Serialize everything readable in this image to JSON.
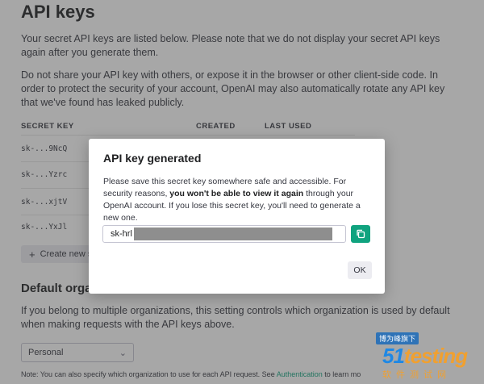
{
  "page": {
    "title": "API keys",
    "intro": "Your secret API keys are listed below. Please note that we do not display your secret API keys again after you generate them.",
    "warning": "Do not share your API key with others, or expose it in the browser or other client-side code. In order to protect the security of your account, OpenAI may also automatically rotate any API key that we've found has leaked publicly."
  },
  "table": {
    "headers": [
      "SECRET KEY",
      "CREATED",
      "LAST USED"
    ],
    "rows": [
      "sk-...9NcQ",
      "sk-...Yzrc",
      "sk-...xjtV",
      "sk-...YxJl"
    ]
  },
  "create_button": "Create new se",
  "default_org": {
    "heading": "Default organ",
    "text": "If you belong to multiple organizations, this setting controls which organization is used by default when making requests with the API keys above.",
    "selected": "Personal",
    "note_prefix": "Note: You can also specify which organization to use for each API request. See ",
    "note_link": "Authentication",
    "note_suffix": " to learn mo"
  },
  "modal": {
    "title": "API key generated",
    "text_a": "Please save this secret key somewhere safe and accessible. For security reasons, ",
    "text_bold": "you won't be able to view it again",
    "text_b": " through your OpenAI account. If you lose this secret key, you'll need to generate a new one.",
    "key_prefix": "sk-hrl",
    "ok_label": "OK"
  },
  "watermark": {
    "top": "博为峰旗下",
    "main_a": "51",
    "main_b": "testing",
    "bottom": "软件测试网"
  },
  "icons": {
    "plus": "plus-icon",
    "chevron": "chevron-down-icon",
    "copy": "copy-icon"
  },
  "colors": {
    "accent": "#10a37f",
    "overlay": "rgba(60,60,60,0.45)"
  }
}
